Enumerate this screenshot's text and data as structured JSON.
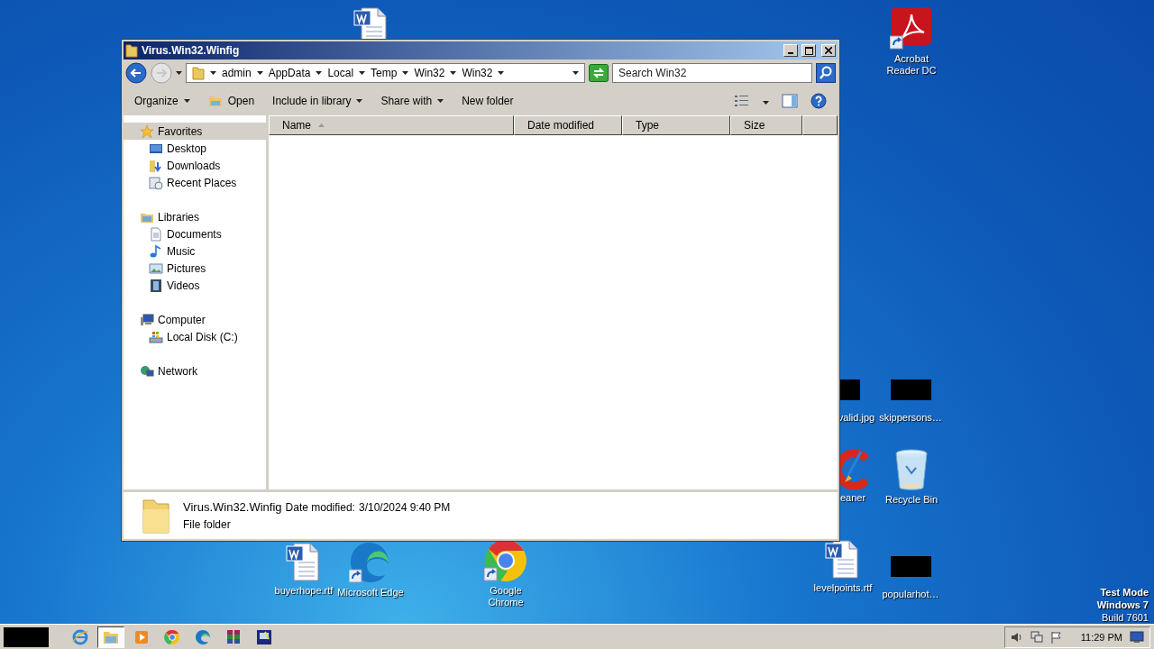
{
  "desktop_icons": [
    {
      "kind": "word"
    },
    {
      "kind": "acrobat",
      "label": "Acrobat Reader DC"
    },
    {
      "kind": "redacted",
      "label": "valid.jpg"
    },
    {
      "kind": "redacted",
      "label": "skippersons…"
    },
    {
      "kind": "ccleaner",
      "label": "eaner"
    },
    {
      "kind": "recycle",
      "label": "Recycle Bin"
    },
    {
      "kind": "word",
      "label": "buyerhope.rtf"
    },
    {
      "kind": "edge",
      "label": "Microsoft Edge"
    },
    {
      "kind": "chrome",
      "label": "Google Chrome"
    },
    {
      "kind": "word",
      "label": "levelpoints.rtf"
    },
    {
      "kind": "redacted",
      "label": "popularhot…"
    }
  ],
  "window": {
    "title": "Virus.Win32.Winfig",
    "breadcrumb": [
      "admin",
      "AppData",
      "Local",
      "Temp",
      "Win32",
      "Win32"
    ],
    "search": {
      "placeholder": "Search Win32"
    },
    "toolbar": [
      {
        "label": "Organize",
        "kind": "menu"
      },
      {
        "label": "Open",
        "kind": "open"
      },
      {
        "label": "Include in library",
        "kind": "menu"
      },
      {
        "label": "Share with",
        "kind": "menu"
      },
      {
        "label": "New folder",
        "kind": "plain"
      }
    ],
    "navigation": [
      {
        "label": "Favorites",
        "kind": "star",
        "selected": true,
        "children": [
          {
            "label": "Desktop",
            "kind": "desktop",
            "selected": false
          },
          {
            "label": "Downloads",
            "kind": "downloads",
            "selected": false
          },
          {
            "label": "Recent Places",
            "kind": "recent",
            "selected": false
          }
        ]
      },
      {
        "label": "Libraries",
        "kind": "libraries",
        "selected": false,
        "children": [
          {
            "label": "Documents",
            "kind": "documents",
            "selected": false
          },
          {
            "label": "Music",
            "kind": "music",
            "selected": false
          },
          {
            "label": "Pictures",
            "kind": "pictures",
            "selected": false
          },
          {
            "label": "Videos",
            "kind": "videos",
            "selected": false
          }
        ]
      },
      {
        "label": "Computer",
        "kind": "computer",
        "selected": false,
        "children": [
          {
            "label": "Local Disk (C:)",
            "kind": "disk",
            "selected": false
          }
        ]
      },
      {
        "label": "Network",
        "kind": "network",
        "selected": false
      }
    ],
    "columns": [
      {
        "label": "Name",
        "sorted": true
      },
      {
        "label": "Date modified",
        "sorted": false
      },
      {
        "label": "Type",
        "sorted": false
      },
      {
        "label": "Size",
        "sorted": false
      }
    ],
    "details": {
      "name": "Virus.Win32.Winfig",
      "date_label": "Date modified:",
      "date": "3/10/2024 9:40 PM",
      "type": "File folder"
    }
  },
  "desktop_notice": [
    "Test Mode",
    "Windows 7",
    "Build 7601"
  ],
  "taskbar": {
    "items": [
      {
        "kind": "ie",
        "selected": false
      },
      {
        "kind": "explorer",
        "selected": true
      },
      {
        "kind": "media",
        "selected": false
      },
      {
        "kind": "chrome",
        "selected": false
      },
      {
        "kind": "edge",
        "selected": false
      },
      {
        "kind": "winrar",
        "selected": false
      },
      {
        "kind": "app",
        "selected": false
      }
    ],
    "clock": "11:29 PM"
  }
}
